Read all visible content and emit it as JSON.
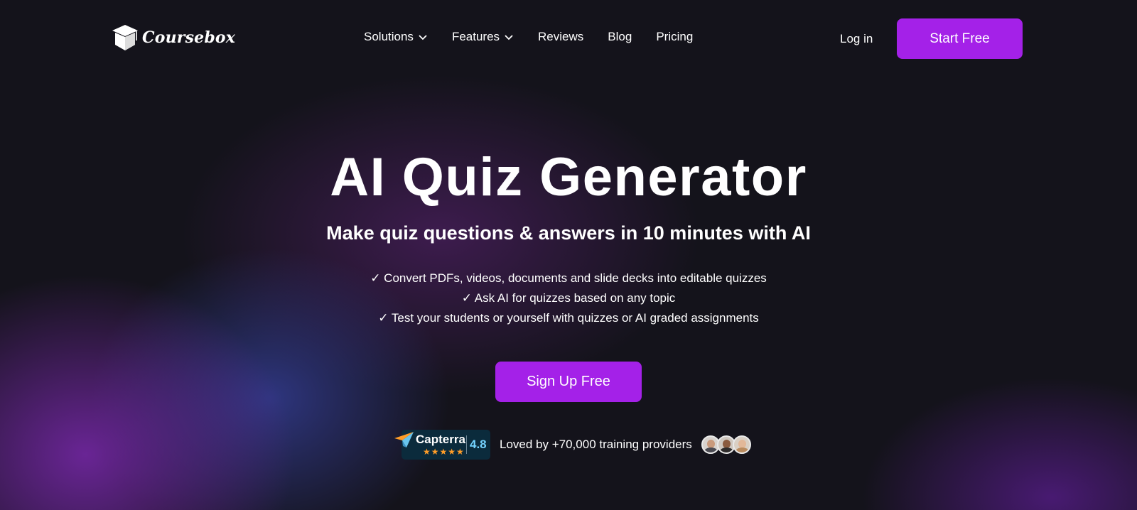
{
  "brand": {
    "name": "Coursebox",
    "logo_icon": "graduation-cap-icon"
  },
  "nav": {
    "items": [
      {
        "label": "Solutions",
        "has_dropdown": true
      },
      {
        "label": "Features",
        "has_dropdown": true
      },
      {
        "label": "Reviews",
        "has_dropdown": false
      },
      {
        "label": "Blog",
        "has_dropdown": false
      },
      {
        "label": "Pricing",
        "has_dropdown": false
      }
    ],
    "login_label": "Log in",
    "cta_label": "Start Free"
  },
  "hero": {
    "title": "AI Quiz Generator",
    "subtitle": "Make quiz questions & answers in 10 minutes with AI",
    "benefits": [
      "✓ Convert PDFs, videos, documents and slide decks into editable quizzes",
      "✓ Ask AI for quizzes based on any topic",
      "✓ Test your students or yourself with quizzes or AI graded assignments"
    ],
    "cta_label": "Sign Up Free"
  },
  "social_proof": {
    "badge_name": "Capterra",
    "rating": "4.8",
    "stars": "★★★★★",
    "text": "Loved by +70,000 training providers"
  },
  "colors": {
    "accent": "#a421e8",
    "background": "#14131b",
    "capterra_bg": "#0b2b3c",
    "capterra_score": "#74d3ff",
    "stars": "#ff9d28"
  }
}
